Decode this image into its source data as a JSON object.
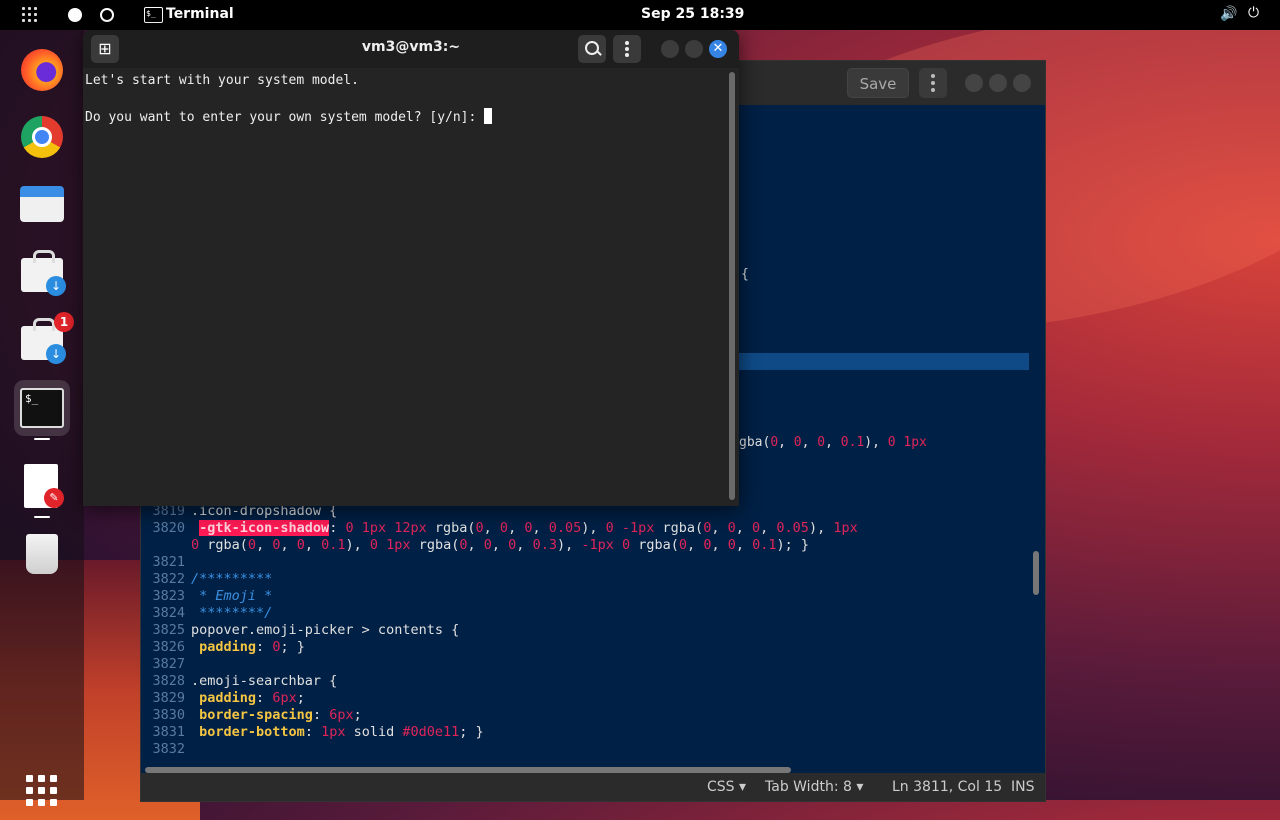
{
  "topbar": {
    "app_name": "Terminal",
    "clock": "Sep 25  18:39",
    "term_glyph": "$_"
  },
  "dock": {
    "items": [
      "Firefox",
      "Chrome",
      "Files",
      "Software",
      "Software Updater",
      "Terminal",
      "Text Editor",
      "Trash",
      "Show Applications"
    ],
    "updates_badge": "1"
  },
  "terminal": {
    "title": "vm3@vm3:~",
    "lines": [
      "Let's start with your system model.",
      "",
      "Do you want to enter your own system model? [y/n]: "
    ]
  },
  "editor": {
    "save_label": "Save",
    "fragment_brace": "{",
    "fragment_rgba": "gba(0, 0, 0, 0.1), 0 1px",
    "status": {
      "language": "CSS",
      "tab_width": "Tab Width: 8",
      "position": "Ln 3811, Col 15",
      "mode": "INS"
    },
    "code_lines": [
      {
        "n": "3819",
        "t": ".icon-dropshadow {"
      },
      {
        "n": "3820",
        "t": "-gtk-icon-shadow: 0 1px 12px rgba(0, 0, 0, 0.05), 0 -1px rgba(0, 0, 0, 0.05), 1px"
      },
      {
        "n": "",
        "t": "0 rgba(0, 0, 0, 0.1), 0 1px rgba(0, 0, 0, 0.3), -1px 0 rgba(0, 0, 0, 0.1); }"
      },
      {
        "n": "3821",
        "t": ""
      },
      {
        "n": "3822",
        "t": "/*********"
      },
      {
        "n": "3823",
        "t": " * Emoji *"
      },
      {
        "n": "3824",
        "t": " ********/"
      },
      {
        "n": "3825",
        "t": "popover.emoji-picker > contents {"
      },
      {
        "n": "3826",
        "t": "padding: 0; }"
      },
      {
        "n": "3827",
        "t": ""
      },
      {
        "n": "3828",
        "t": ".emoji-searchbar {"
      },
      {
        "n": "3829",
        "t": "padding: 6px;"
      },
      {
        "n": "3830",
        "t": "border-spacing: 6px;"
      },
      {
        "n": "3831",
        "t": "border-bottom: 1px solid #0d0e11; }"
      },
      {
        "n": "3832",
        "t": ""
      }
    ]
  },
  "colors": {
    "accent": "#3584e4",
    "editor_bg": "#002045",
    "terminal_bg": "#242424",
    "css_property": "#f4c542",
    "css_number": "#e0245a",
    "css_comment": "#3a8fe0"
  }
}
